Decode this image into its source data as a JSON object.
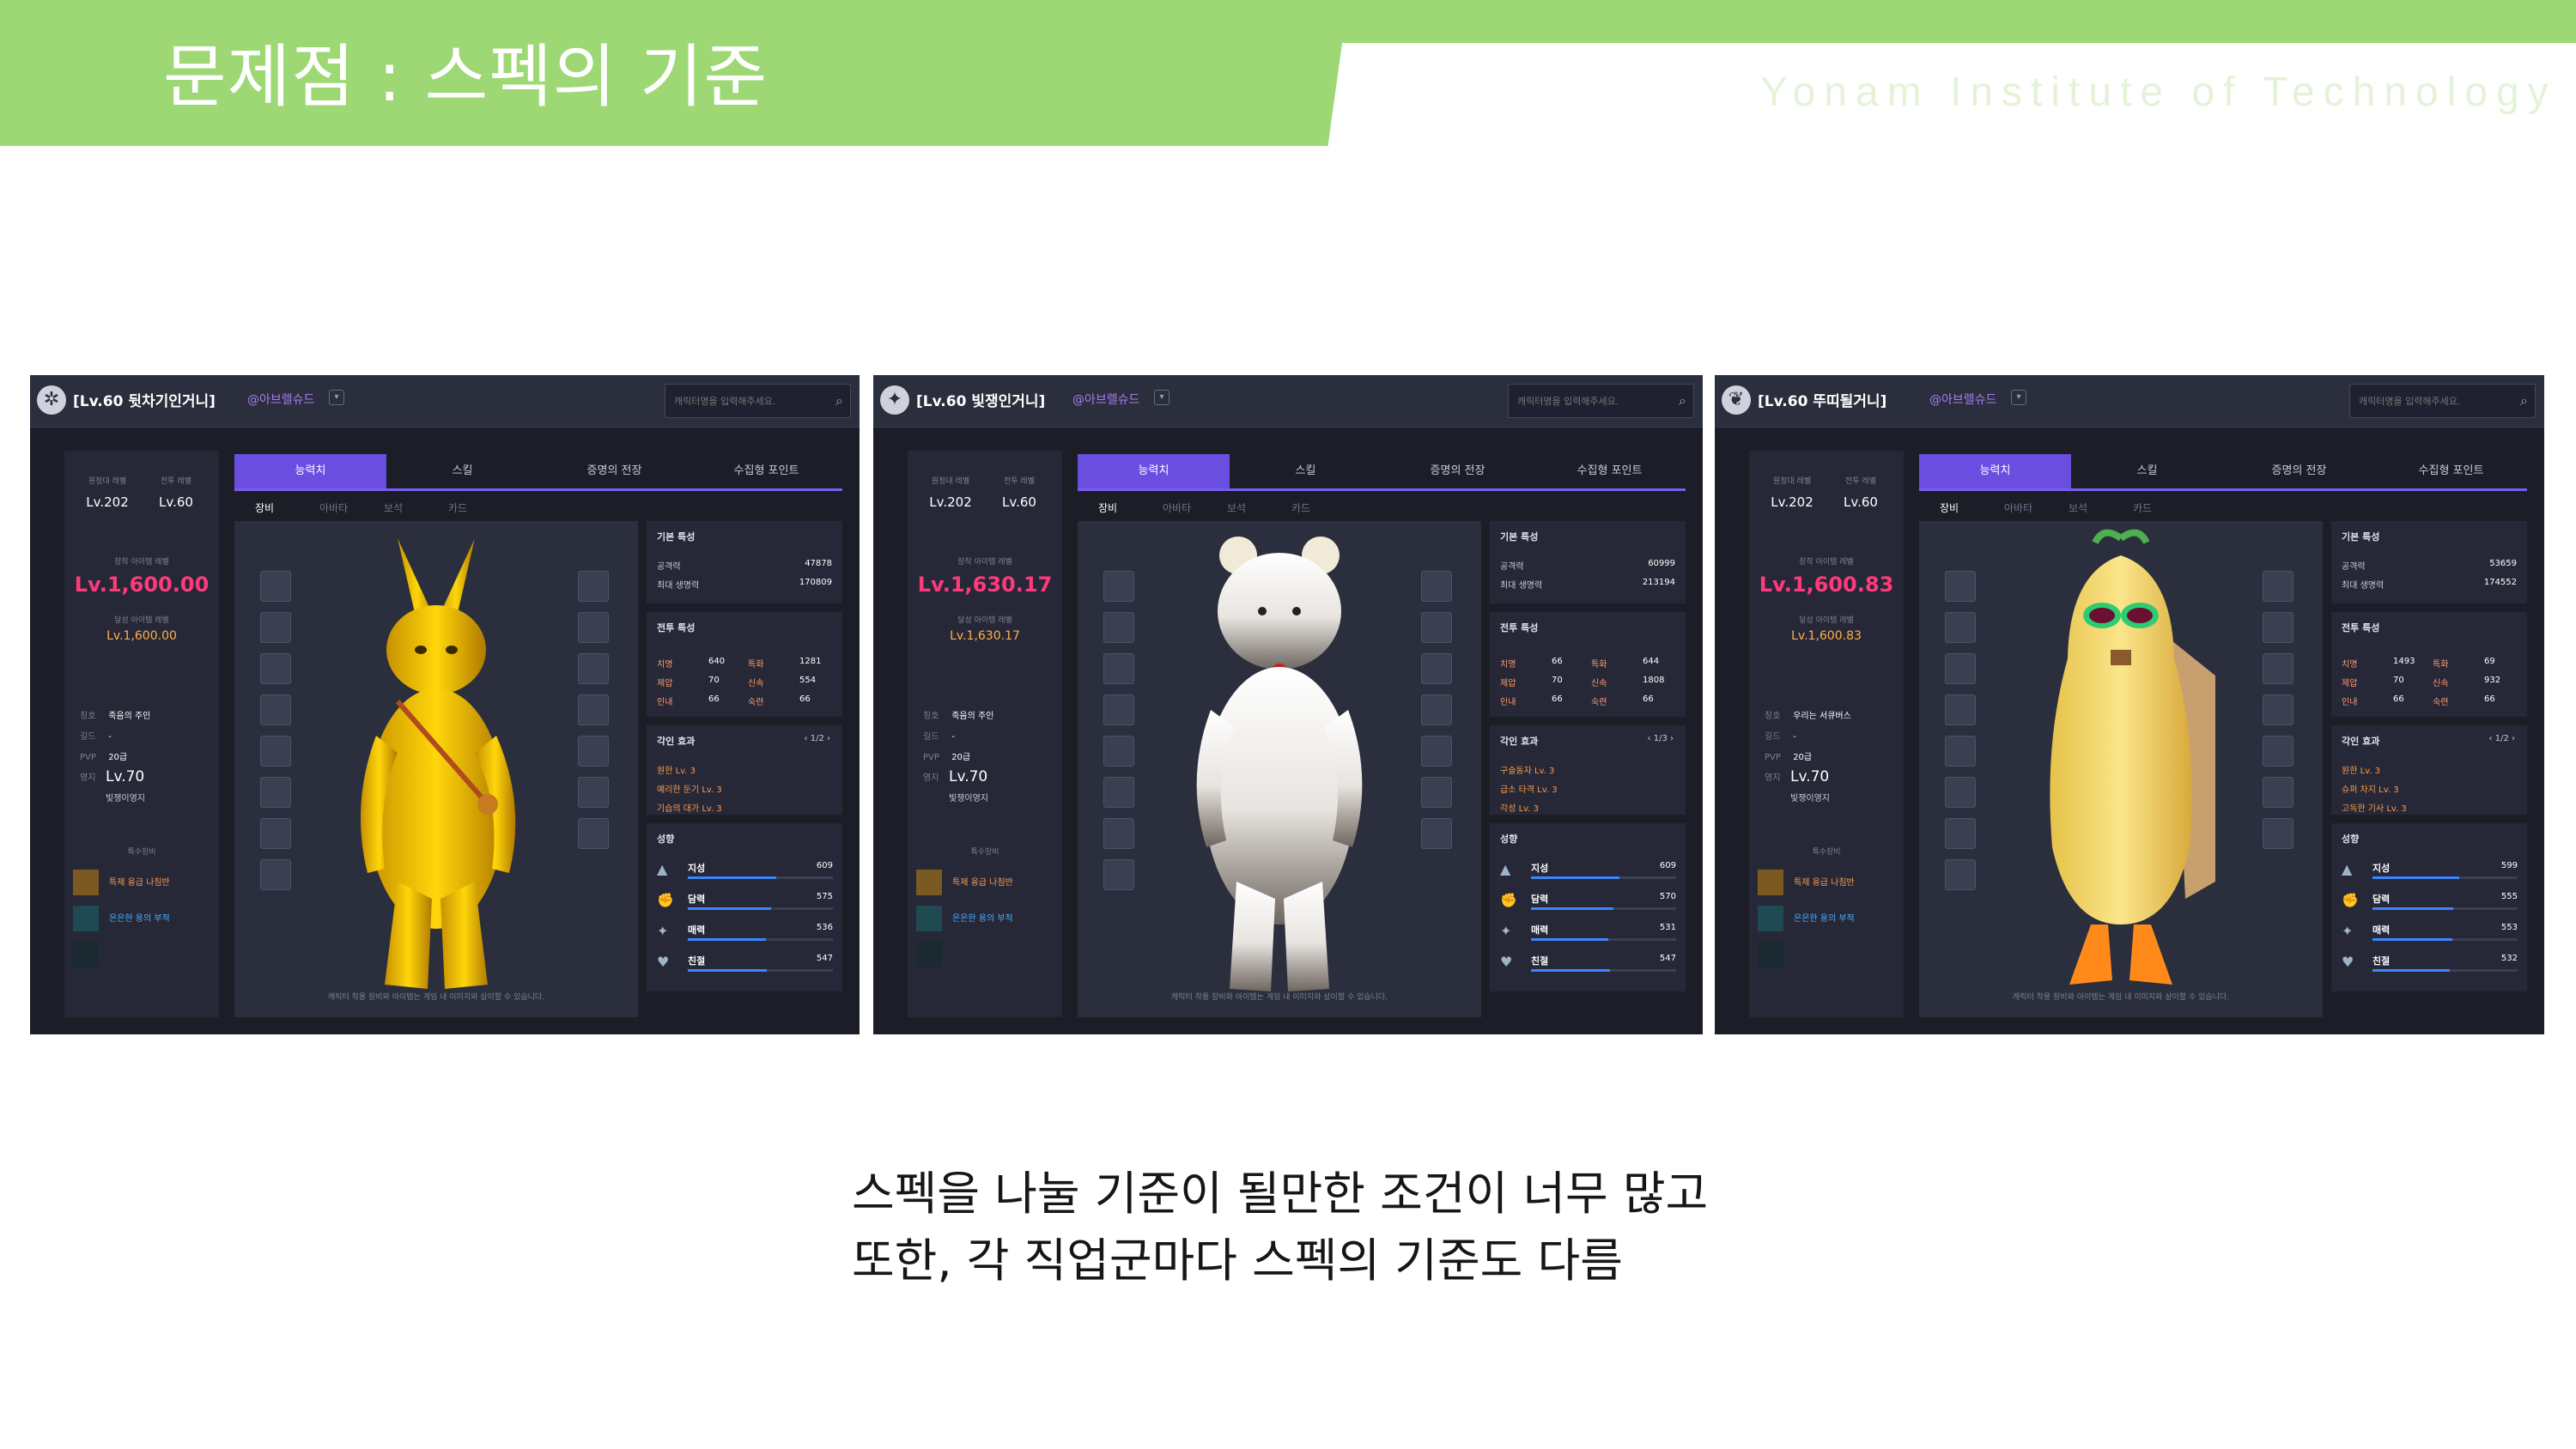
{
  "header": {
    "title": "문제점 : 스펙의 기준",
    "institute": "Yonam Institute of Technology"
  },
  "caption": {
    "line1": "스펙을 나눌 기준이 될만한 조건이 너무 많고",
    "line2": "또한, 각 직업군마다 스펙의 기준도 다름"
  },
  "colors": {
    "accent_green": "#9dd874",
    "tab_purple": "#6a4ee0",
    "item_level_pink": "#ff3a7a",
    "stat_bar_blue": "#3a86ff"
  },
  "panels": [
    {
      "char_name": "[Lv.60 뒷차기인거니]",
      "guild": "@아브렐슈드",
      "search_placeholder": "캐릭터명을 입력해주세요.",
      "expedition_label": "원정대 레벨",
      "expedition_value": "Lv.202",
      "battle_label": "전투 레벨",
      "battle_value": "Lv.60",
      "item_label": "장착 아이템 레벨",
      "item_level": "Lv.1,600.00",
      "item_label2": "달성 아이템 레벨",
      "item_level2": "Lv.1,600.00",
      "info": [
        {
          "k": "칭호",
          "v": "죽음의 주인"
        },
        {
          "k": "길드",
          "v": "-"
        },
        {
          "k": "PVP",
          "v": "20급"
        },
        {
          "k": "영지",
          "v": ""
        }
      ],
      "pvp_big": "Lv.70",
      "pvp_sub": "빛쟁이영지",
      "special_label": "특수장비",
      "special_items": [
        "특제 융급 나침반",
        "은은한 용의 부적"
      ],
      "tabs": [
        "능력치",
        "스킬",
        "증명의 전장",
        "수집형 포인트"
      ],
      "subtabs": [
        "장비",
        "아바타",
        "보석",
        "카드"
      ],
      "viewer_note": "캐릭터 착용 장비와 아이템는 게임 내 이미지와 상이할 수 있습니다.",
      "basic_title": "기본 특성",
      "basic": [
        {
          "k": "공격력",
          "v": "47878"
        },
        {
          "k": "최대 생명력",
          "v": "170809"
        }
      ],
      "combat_title": "전투 특성",
      "combat": [
        {
          "k": "치명",
          "v": "640"
        },
        {
          "k": "특화",
          "v": "1281"
        },
        {
          "k": "제압",
          "v": "70"
        },
        {
          "k": "신속",
          "v": "554"
        },
        {
          "k": "인내",
          "v": "66"
        },
        {
          "k": "숙련",
          "v": "66"
        }
      ],
      "engrave_title": "각인 효과",
      "engrave_pager": "1/2",
      "engravings": [
        "원한 Lv. 3",
        "예리한 둔기 Lv. 3",
        "기습의 대가 Lv. 3"
      ],
      "tendency_title": "성향",
      "tendency": [
        {
          "k": "지성",
          "v": "609",
          "icon": "book-icon",
          "ratio": 0.61
        },
        {
          "k": "담력",
          "v": "575",
          "icon": "fist-icon",
          "ratio": 0.575
        },
        {
          "k": "매력",
          "v": "536",
          "icon": "sparkle-icon",
          "ratio": 0.536
        },
        {
          "k": "친절",
          "v": "547",
          "icon": "heart-hand-icon",
          "ratio": 0.547
        }
      ]
    },
    {
      "char_name": "[Lv.60 빛쟁인거니]",
      "guild": "@아브렐슈드",
      "search_placeholder": "캐릭터명을 입력해주세요.",
      "expedition_label": "원정대 레벨",
      "expedition_value": "Lv.202",
      "battle_label": "전투 레벨",
      "battle_value": "Lv.60",
      "item_label": "장착 아이템 레벨",
      "item_level": "Lv.1,630.17",
      "item_label2": "달성 아이템 레벨",
      "item_level2": "Lv.1,630.17",
      "info": [
        {
          "k": "칭호",
          "v": "죽음의 주인"
        },
        {
          "k": "길드",
          "v": "-"
        },
        {
          "k": "PVP",
          "v": "20급"
        },
        {
          "k": "영지",
          "v": ""
        }
      ],
      "pvp_big": "Lv.70",
      "pvp_sub": "빛쟁이영지",
      "special_label": "특수장비",
      "special_items": [
        "특제 융급 나침반",
        "은은한 용의 부적"
      ],
      "tabs": [
        "능력치",
        "스킬",
        "증명의 전장",
        "수집형 포인트"
      ],
      "subtabs": [
        "장비",
        "아바타",
        "보석",
        "카드"
      ],
      "viewer_note": "캐릭터 착용 장비와 아이템는 게임 내 이미지와 상이할 수 있습니다.",
      "basic_title": "기본 특성",
      "basic": [
        {
          "k": "공격력",
          "v": "60999"
        },
        {
          "k": "최대 생명력",
          "v": "213194"
        }
      ],
      "combat_title": "전투 특성",
      "combat": [
        {
          "k": "치명",
          "v": "66"
        },
        {
          "k": "특화",
          "v": "644"
        },
        {
          "k": "제압",
          "v": "70"
        },
        {
          "k": "신속",
          "v": "1808"
        },
        {
          "k": "인내",
          "v": "66"
        },
        {
          "k": "숙련",
          "v": "66"
        }
      ],
      "engrave_title": "각인 효과",
      "engrave_pager": "1/3",
      "engravings": [
        "구슬동자 Lv. 3",
        "급소 타격 Lv. 3",
        "각성 Lv. 3"
      ],
      "tendency_title": "성향",
      "tendency": [
        {
          "k": "지성",
          "v": "609",
          "icon": "book-icon",
          "ratio": 0.61
        },
        {
          "k": "담력",
          "v": "570",
          "icon": "fist-icon",
          "ratio": 0.57
        },
        {
          "k": "매력",
          "v": "531",
          "icon": "sparkle-icon",
          "ratio": 0.531
        },
        {
          "k": "친절",
          "v": "547",
          "icon": "heart-hand-icon",
          "ratio": 0.547
        }
      ]
    },
    {
      "char_name": "[Lv.60 뚜띠될거니]",
      "guild": "@아브렐슈드",
      "search_placeholder": "캐릭터명을 입력해주세요.",
      "expedition_label": "원정대 레벨",
      "expedition_value": "Lv.202",
      "battle_label": "전투 레벨",
      "battle_value": "Lv.60",
      "item_label": "장착 아이템 레벨",
      "item_level": "Lv.1,600.83",
      "item_label2": "달성 아이템 레벨",
      "item_level2": "Lv.1,600.83",
      "info": [
        {
          "k": "칭호",
          "v": "우리는 서큐버스"
        },
        {
          "k": "길드",
          "v": "-"
        },
        {
          "k": "PVP",
          "v": "20급"
        },
        {
          "k": "영지",
          "v": ""
        }
      ],
      "pvp_big": "Lv.70",
      "pvp_sub": "빛쟁이영지",
      "special_label": "특수장비",
      "special_items": [
        "특제 융급 나침반",
        "은은한 용의 부적"
      ],
      "tabs": [
        "능력치",
        "스킬",
        "증명의 전장",
        "수집형 포인트"
      ],
      "subtabs": [
        "장비",
        "아바타",
        "보석",
        "카드"
      ],
      "viewer_note": "캐릭터 착용 장비와 아이템는 게임 내 이미지와 상이할 수 있습니다.",
      "basic_title": "기본 특성",
      "basic": [
        {
          "k": "공격력",
          "v": "53659"
        },
        {
          "k": "최대 생명력",
          "v": "174552"
        }
      ],
      "combat_title": "전투 특성",
      "combat": [
        {
          "k": "치명",
          "v": "1493"
        },
        {
          "k": "특화",
          "v": "69"
        },
        {
          "k": "제압",
          "v": "70"
        },
        {
          "k": "신속",
          "v": "932"
        },
        {
          "k": "인내",
          "v": "66"
        },
        {
          "k": "숙련",
          "v": "66"
        }
      ],
      "engrave_title": "각인 효과",
      "engrave_pager": "1/2",
      "engravings": [
        "원한 Lv. 3",
        "슈퍼 차지 Lv. 3",
        "고독한 기사 Lv. 3"
      ],
      "tendency_title": "성향",
      "tendency": [
        {
          "k": "지성",
          "v": "599",
          "icon": "book-icon",
          "ratio": 0.599
        },
        {
          "k": "담력",
          "v": "555",
          "icon": "fist-icon",
          "ratio": 0.555
        },
        {
          "k": "매력",
          "v": "553",
          "icon": "sparkle-icon",
          "ratio": 0.553
        },
        {
          "k": "친절",
          "v": "532",
          "icon": "heart-hand-icon",
          "ratio": 0.532
        }
      ]
    }
  ]
}
